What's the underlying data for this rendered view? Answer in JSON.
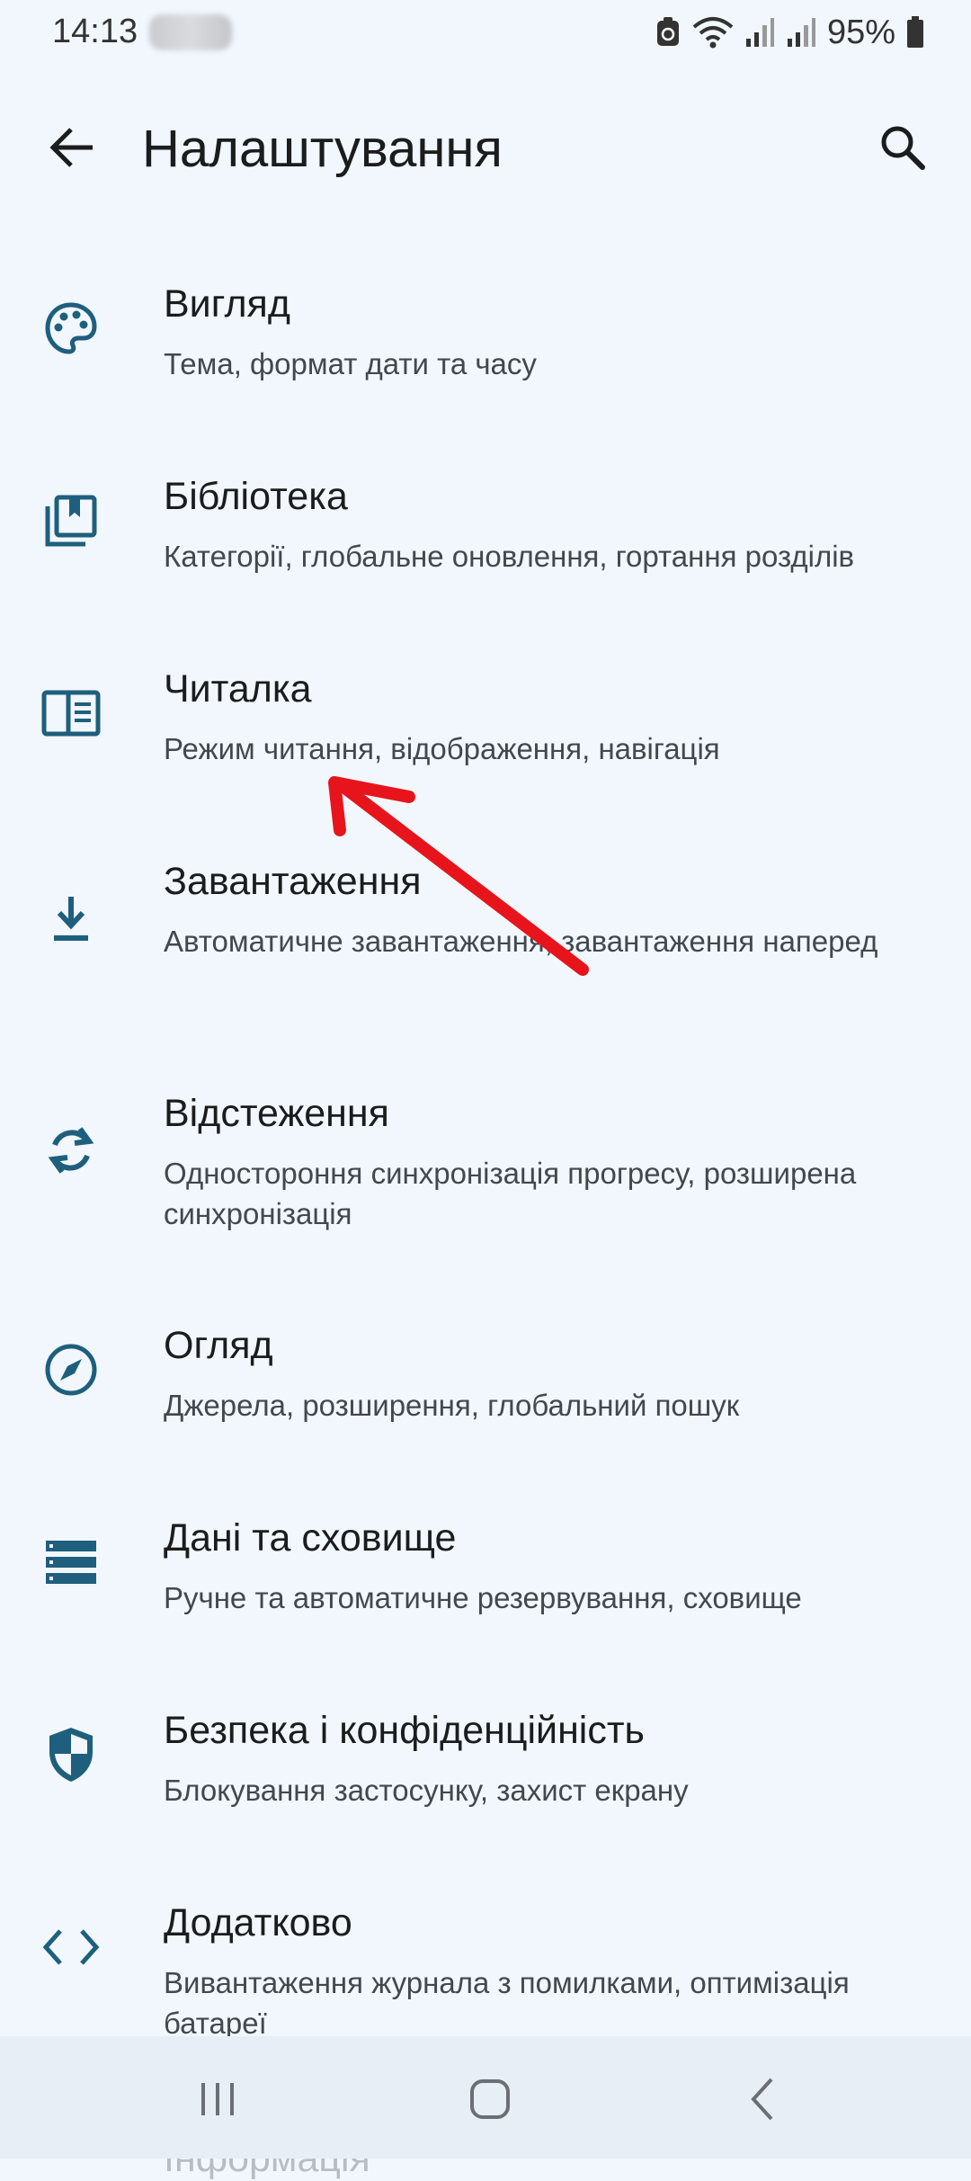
{
  "status_bar": {
    "time": "14:13",
    "battery": "95%",
    "icons": [
      "recycle-icon",
      "wifi-icon",
      "signal-icon",
      "signal-icon",
      "battery-icon"
    ]
  },
  "app_bar": {
    "title": "Налаштування",
    "back_icon": "arrow-back-icon",
    "search_icon": "search-icon"
  },
  "settings": [
    {
      "icon": "palette-icon",
      "title": "Вигляд",
      "subtitle": "Тема, формат дати та часу"
    },
    {
      "icon": "library-icon",
      "title": "Бібліотека",
      "subtitle": "Категорії, глобальне оновлення, гортання розділів"
    },
    {
      "icon": "reader-icon",
      "title": "Читалка",
      "subtitle": "Режим читання, відображення, навігація"
    },
    {
      "icon": "download-icon",
      "title": "Завантаження",
      "subtitle": "Автоматичне завантаження, завантаження наперед"
    },
    {
      "icon": "sync-icon",
      "title": "Відстеження",
      "subtitle": "Одностороння синхронізація прогресу, розширена синхронізація"
    },
    {
      "icon": "compass-icon",
      "title": "Огляд",
      "subtitle": "Джерела, розширення, глобальний пошук"
    },
    {
      "icon": "storage-icon",
      "title": "Дані та сховище",
      "subtitle": "Ручне та автоматичне резервування, сховище"
    },
    {
      "icon": "shield-icon",
      "title": "Безпека і конфіденційність",
      "subtitle": "Блокування застосунку, захист екрану"
    },
    {
      "icon": "code-icon",
      "title": "Додатково",
      "subtitle": "Вивантаження журнала з помилками, оптимізація батареї"
    }
  ],
  "peek_item": {
    "title": "Інформація"
  },
  "nav_bar": {
    "recents_icon": "recents-icon",
    "home_icon": "home-icon",
    "back_icon": "nav-back-icon"
  },
  "colors": {
    "background": "#f1f7fd",
    "icon": "#1e5f7d",
    "annotation_arrow": "#e8141b",
    "nav_bar": "#e8eef6"
  }
}
